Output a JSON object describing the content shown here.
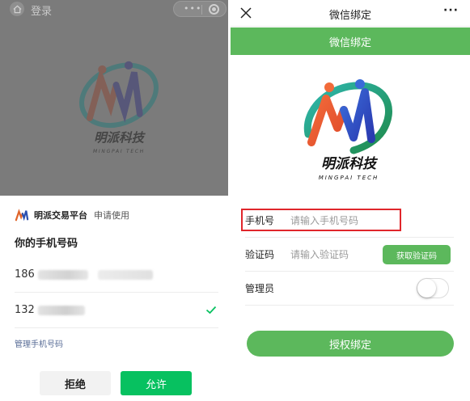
{
  "colors": {
    "wechat_green": "#07c160",
    "brand_green": "#5cb85c",
    "link_blue": "#576b95",
    "highlight_red": "#e0262b",
    "overlay_gray": "#7b7b7b"
  },
  "left": {
    "nav": {
      "title": "登录",
      "home_icon": "home-icon",
      "more_icon": "more-dots-icon",
      "record_icon": "record-icon"
    },
    "logo": {
      "cn": "明派科技",
      "en": "MINGPAI TECH"
    },
    "sheet": {
      "app_name": "明派交易平台",
      "request_text": "申请使用",
      "question": "你的手机号码",
      "phones": [
        {
          "prefix": "186",
          "selected": false
        },
        {
          "prefix": "132",
          "selected": true
        }
      ],
      "manage_link": "管理手机号码",
      "reject_label": "拒绝",
      "allow_label": "允许"
    }
  },
  "right": {
    "nav": {
      "title": "微信绑定",
      "close_icon": "close-icon",
      "more_icon": "more-dots-icon"
    },
    "banner": "微信绑定",
    "logo": {
      "cn": "明派科技",
      "en": "MINGPAI TECH"
    },
    "form": {
      "phone_label": "手机号",
      "phone_placeholder": "请输入手机号码",
      "code_label": "验证码",
      "code_placeholder": "请输入验证码",
      "get_code_label": "获取验证码",
      "admin_label": "管理员",
      "admin_enabled": false
    },
    "submit_label": "授权绑定"
  }
}
